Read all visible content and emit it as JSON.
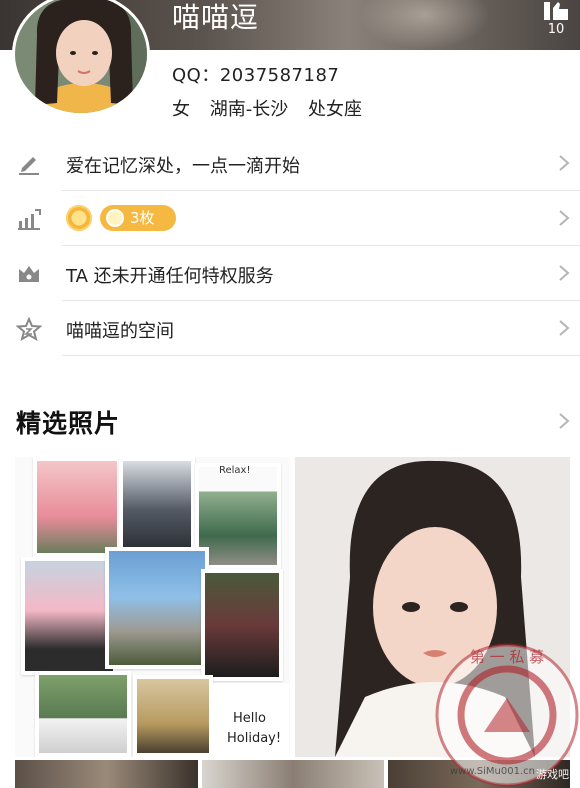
{
  "profile": {
    "nickname": "喵喵逗",
    "like_count": "10",
    "qq": "QQ：2037587187",
    "gender": "女",
    "location": "湖南-长沙",
    "zodiac": "处女座"
  },
  "list": {
    "signature": "爱在记忆深处，一点一滴开始",
    "medal_count": "3枚",
    "privilege": "TA 还未开通任何特权服务",
    "space": "喵喵逗的空间"
  },
  "photos": {
    "title": "精选照片",
    "collage_caption_1": "Hello",
    "collage_caption_2": "Holiday!",
    "collage_relax": "Relax!"
  },
  "watermark": {
    "chars": "第一私募",
    "url": "www.SiMu001.cn",
    "tag": "游戏吧"
  },
  "colors": {
    "accent_gold": "#f5b840",
    "divider": "#e6e6e6",
    "watermark_red": "#b0222a"
  }
}
